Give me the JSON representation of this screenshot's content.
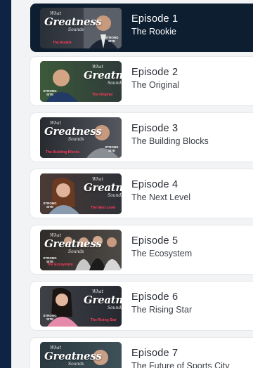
{
  "colors": {
    "page_background": "#0f2345",
    "panel_background": "#f2f3f5",
    "active_row": "#0d1e30",
    "row": "#ffffff",
    "tag_accent": "#ff3b5c"
  },
  "thumbnail_brand": {
    "top": "What",
    "main": "Greatness",
    "bottom": "Sounds",
    "badge": "STRONG SITE"
  },
  "episodes": [
    {
      "title": "Episode 1",
      "subtitle": "The Rookie",
      "tag": "The Rookie",
      "active": true
    },
    {
      "title": "Episode 2",
      "subtitle": "The Original",
      "tag": "The Original",
      "active": false
    },
    {
      "title": "Episode 3",
      "subtitle": "The Building Blocks",
      "tag": "The Building Blocks",
      "active": false
    },
    {
      "title": "Episode 4",
      "subtitle": "The Next Level",
      "tag": "The Next Level",
      "active": false
    },
    {
      "title": "Episode 5",
      "subtitle": "The Ecosystem",
      "tag": "The Ecosystem",
      "active": false
    },
    {
      "title": "Episode 6",
      "subtitle": "The Rising Star",
      "tag": "The Rising Star",
      "active": false
    },
    {
      "title": "Episode 7",
      "subtitle": "The Future of Sports City",
      "tag": "",
      "active": false
    }
  ]
}
